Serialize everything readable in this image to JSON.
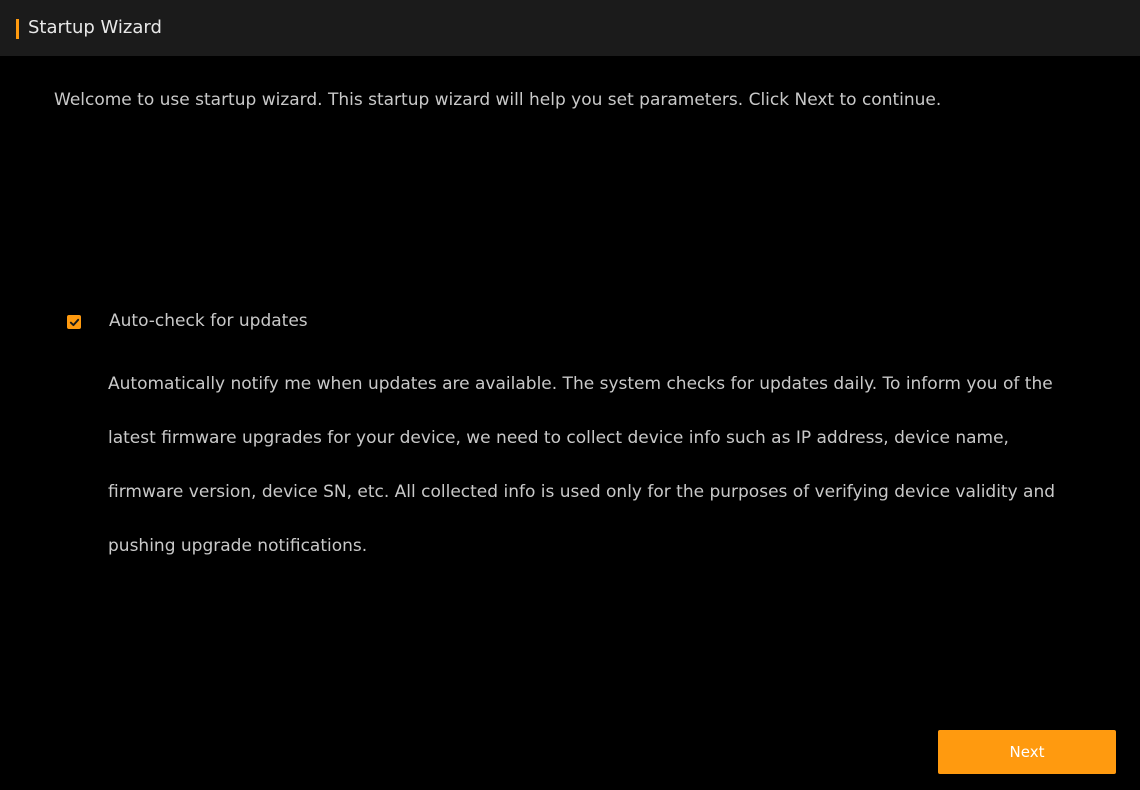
{
  "window": {
    "title": "Startup Wizard",
    "accent_color": "#ff9a0f"
  },
  "welcome": {
    "text": "Welcome to use startup wizard. This startup wizard will help you set parameters. Click Next to continue."
  },
  "auto_check": {
    "checked": true,
    "icon": "checkmark-icon",
    "label": "Auto-check for updates",
    "description": "Automatically notify me when updates are available. The system checks for updates daily. To inform you of the latest firmware upgrades for your device, we need to collect device info such as IP address, device name, firmware version, device SN, etc. All collected info is used only for the purposes of verifying device validity and pushing upgrade notifications."
  },
  "footer": {
    "next_label": "Next"
  }
}
